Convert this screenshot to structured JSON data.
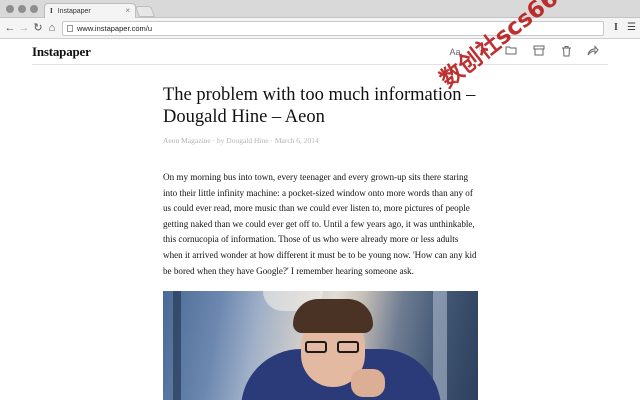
{
  "browser": {
    "tab_title": "Instapaper",
    "tab_favicon": "I",
    "tab_close": "×",
    "url": "www.instapaper.com/u",
    "extension_label": "I",
    "icons": [
      "back-icon",
      "forward-icon",
      "reload-icon",
      "home-icon",
      "page-icon",
      "menu-icon"
    ]
  },
  "header": {
    "logo": "Instapaper",
    "font_button": "Aa",
    "icons": [
      "font-icon",
      "heart-icon",
      "folder-icon",
      "archive-icon",
      "trash-icon",
      "share-icon"
    ]
  },
  "article": {
    "title": "The problem with too much information – Dougald Hine – Aeon",
    "byline": "Aeon Magazine · by Dougald Hine · March 6, 2014",
    "body": "On my morning bus into town, every teenager and every grown-up sits there staring into their little infinity machine: a pocket-sized window onto more words than any of us could ever read, more music than we could ever listen to, more pictures of people getting naked than we could ever get off to. Until a few years ago, it was unthinkable, this cornucopia of information. Those of us who were already more or less adults when it arrived wonder at how different it must be to be young now. 'How can any kid be bored when they have Google?' I remember hearing someone ask."
  },
  "watermark": "数创社scs66",
  "colors": {
    "chrome_bg": "#d9d9d9",
    "toolbar_bg": "#f4f4f4",
    "byline": "#b5b5b5",
    "watermark": "#b81a1a",
    "jacket": "#2b3a78"
  }
}
